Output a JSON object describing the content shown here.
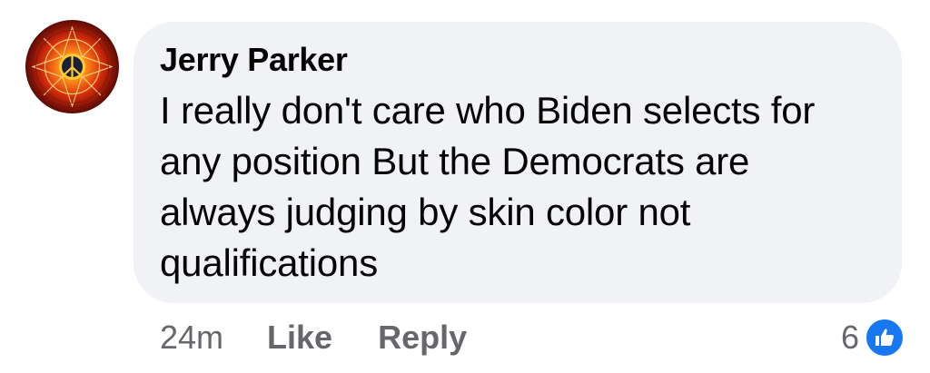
{
  "comment": {
    "author": "Jerry Parker",
    "text": "I really don't care who Biden selects for any position But the Democrats are always judging by skin color not qualifications",
    "timestamp": "24m",
    "like_label": "Like",
    "reply_label": "Reply",
    "reaction_count": "6",
    "reaction_icon": "thumbs-up-icon",
    "avatar_icon": "peace-sign-icon"
  },
  "colors": {
    "bubble_background": "#f0f2f5",
    "text": "#050505",
    "secondary_text": "#65676b",
    "like_blue": "#1877f2"
  }
}
